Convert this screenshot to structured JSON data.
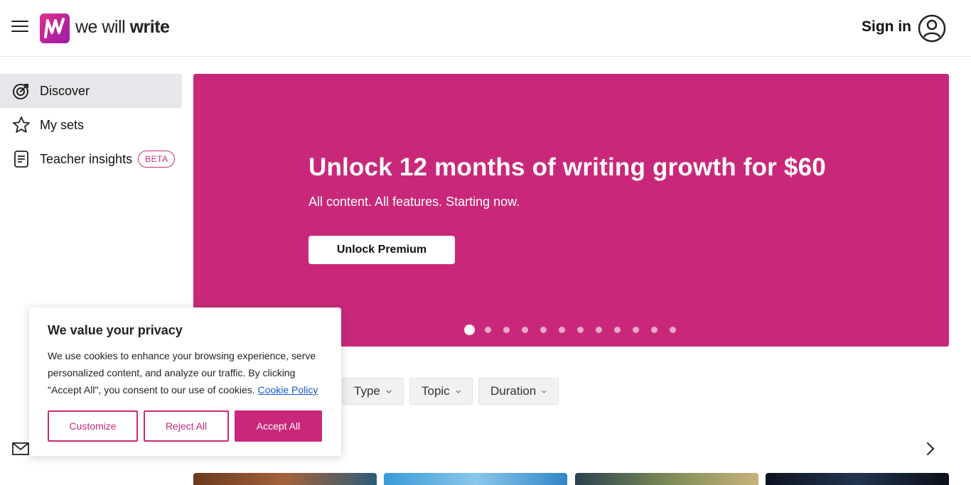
{
  "brand": {
    "logo_prefix": "we will",
    "logo_strong": "write",
    "accent": "#c9287a"
  },
  "header": {
    "signin_label": "Sign in",
    "icons": [
      "menu-icon",
      "user-icon"
    ]
  },
  "sidebar": {
    "items": [
      {
        "label": "Discover",
        "icon": "target-icon",
        "active": true
      },
      {
        "label": "My sets",
        "icon": "star-icon",
        "active": false
      },
      {
        "label": "Teacher insights",
        "icon": "document-icon",
        "active": false,
        "badge": "BETA"
      }
    ]
  },
  "hero": {
    "title": "Unlock 12 months of writing growth for $60",
    "subtitle": "All content. All features. Starting now.",
    "cta_label": "Unlock Premium",
    "slide_count": 12,
    "active_slide": 1,
    "background": "#c9287a"
  },
  "filters": [
    {
      "label": "Type"
    },
    {
      "label": "Topic"
    },
    {
      "label": "Duration"
    }
  ],
  "cookie_banner": {
    "title": "We value your privacy",
    "body": "We use cookies to enhance your browsing experience, serve personalized content, and analyze our traffic. By clicking \"Accept All\", you consent to our use of cookies.",
    "link_label": "Cookie Policy",
    "customize_label": "Customize",
    "reject_label": "Reject All",
    "accept_label": "Accept All"
  }
}
